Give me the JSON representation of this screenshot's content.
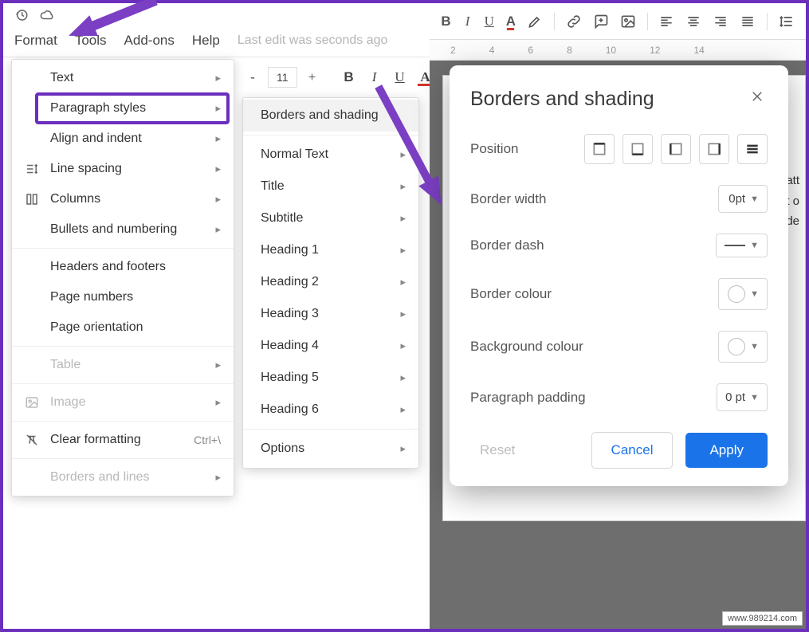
{
  "menubar": {
    "format": "Format",
    "tools": "Tools",
    "addons": "Add-ons",
    "help": "Help",
    "edit_status": "Last edit was seconds ago"
  },
  "toolbar_left": {
    "minus": "-",
    "fontsize": "11",
    "plus": "+",
    "bold": "B",
    "italic": "I",
    "underline": "U",
    "textcolor": "A"
  },
  "format_menu": {
    "text": "Text",
    "paragraph": "Paragraph styles",
    "align": "Align and indent",
    "line_spacing": "Line spacing",
    "columns": "Columns",
    "bullets": "Bullets and numbering",
    "headers": "Headers and footers",
    "page_numbers": "Page numbers",
    "page_orientation": "Page orientation",
    "table": "Table",
    "image": "Image",
    "clear": "Clear formatting",
    "clear_shortcut": "Ctrl+\\",
    "borders_lines": "Borders and lines"
  },
  "submenu": {
    "borders_shading": "Borders and shading",
    "normal": "Normal Text",
    "title": "Title",
    "subtitle": "Subtitle",
    "h1": "Heading 1",
    "h2": "Heading 2",
    "h3": "Heading 3",
    "h4": "Heading 4",
    "h5": "Heading 5",
    "h6": "Heading 6",
    "options": "Options"
  },
  "ruler": {
    "t1": "2",
    "t3": "4",
    "t5": "6",
    "t8": "8",
    "t10": "10",
    "t12": "12",
    "t14": "14"
  },
  "doc_text": {
    "l1": "att",
    "l2": "t o",
    "l3": "de"
  },
  "toolbar_right": {
    "bold": "B",
    "italic": "I",
    "underline": "U",
    "textcolor": "A"
  },
  "dialog": {
    "title": "Borders and shading",
    "position": "Position",
    "border_width": "Border width",
    "border_width_val": "0pt",
    "border_dash": "Border dash",
    "border_colour": "Border colour",
    "background_colour": "Background colour",
    "paragraph_padding": "Paragraph padding",
    "paragraph_padding_val": "0 pt",
    "reset": "Reset",
    "cancel": "Cancel",
    "apply": "Apply"
  },
  "watermark": "www.989214.com"
}
